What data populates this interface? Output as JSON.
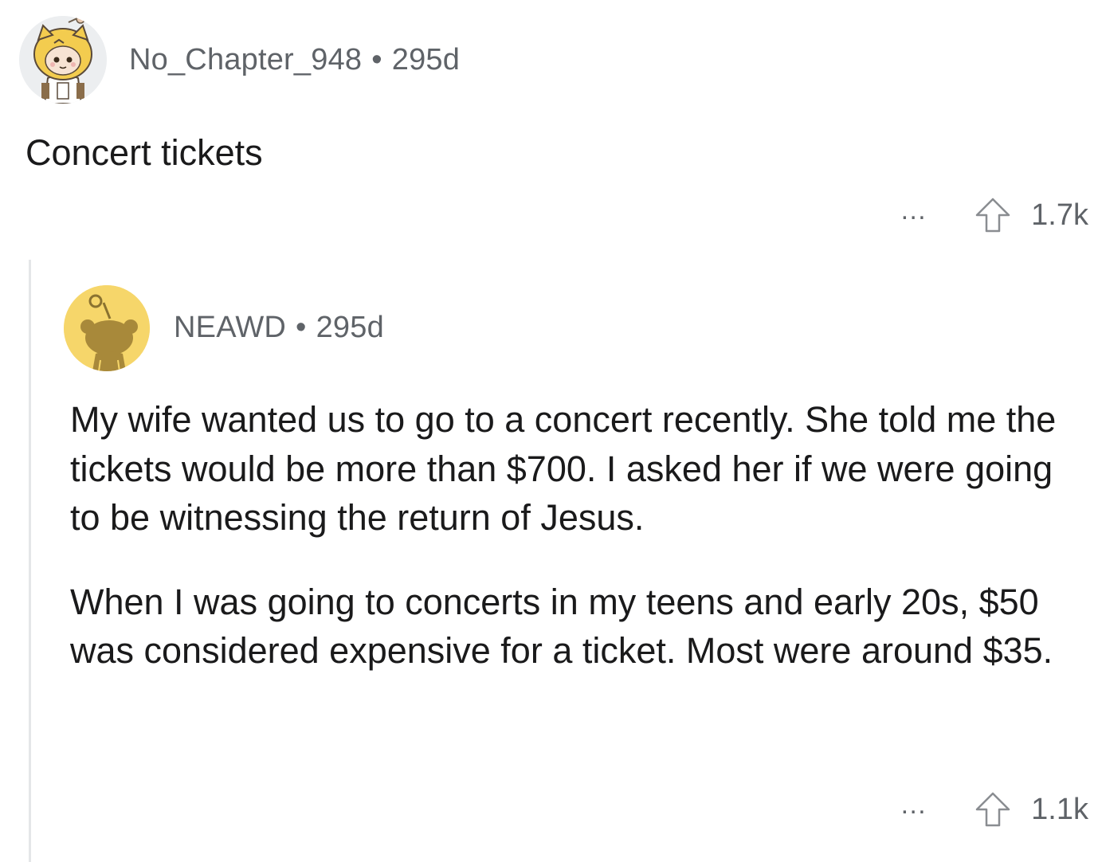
{
  "comments": [
    {
      "author": "No_Chapter_948",
      "separator": "•",
      "age": "295d",
      "avatar_icon": "snoo-shiba-costume-avatar-icon",
      "body": [
        "Concert tickets"
      ],
      "more_label": "…",
      "upvote_icon": "upvote-arrow-icon",
      "score": "1.7k"
    },
    {
      "author": "NEAWD",
      "separator": "•",
      "age": "295d",
      "avatar_icon": "snoo-default-yellow-avatar-icon",
      "body": [
        "My wife wanted us to go to a concert recently. She told me the tickets would be more than $700. I asked her if we were going to be witnessing the return of Jesus.",
        "When I was going to concerts in my teens and early 20s, $50 was considered expensive for a ticket. Most were around $35."
      ],
      "more_label": "…",
      "upvote_icon": "upvote-arrow-icon",
      "score": "1.1k"
    }
  ],
  "colors": {
    "meta_text": "#5f6368",
    "body_text": "#1a1a1b",
    "thread_line": "#e4e6e8",
    "avatar_yellow": "#f6d66a"
  }
}
